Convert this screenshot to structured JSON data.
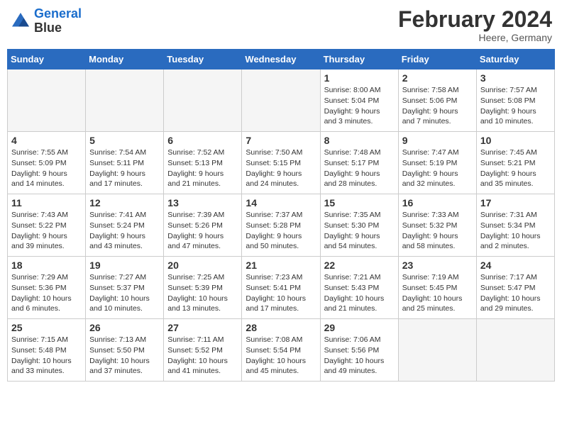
{
  "header": {
    "logo_line1": "General",
    "logo_line2": "Blue",
    "month_title": "February 2024",
    "subtitle": "Heere, Germany"
  },
  "days_of_week": [
    "Sunday",
    "Monday",
    "Tuesday",
    "Wednesday",
    "Thursday",
    "Friday",
    "Saturday"
  ],
  "weeks": [
    [
      {
        "day": "",
        "info": ""
      },
      {
        "day": "",
        "info": ""
      },
      {
        "day": "",
        "info": ""
      },
      {
        "day": "",
        "info": ""
      },
      {
        "day": "1",
        "info": "Sunrise: 8:00 AM\nSunset: 5:04 PM\nDaylight: 9 hours\nand 3 minutes."
      },
      {
        "day": "2",
        "info": "Sunrise: 7:58 AM\nSunset: 5:06 PM\nDaylight: 9 hours\nand 7 minutes."
      },
      {
        "day": "3",
        "info": "Sunrise: 7:57 AM\nSunset: 5:08 PM\nDaylight: 9 hours\nand 10 minutes."
      }
    ],
    [
      {
        "day": "4",
        "info": "Sunrise: 7:55 AM\nSunset: 5:09 PM\nDaylight: 9 hours\nand 14 minutes."
      },
      {
        "day": "5",
        "info": "Sunrise: 7:54 AM\nSunset: 5:11 PM\nDaylight: 9 hours\nand 17 minutes."
      },
      {
        "day": "6",
        "info": "Sunrise: 7:52 AM\nSunset: 5:13 PM\nDaylight: 9 hours\nand 21 minutes."
      },
      {
        "day": "7",
        "info": "Sunrise: 7:50 AM\nSunset: 5:15 PM\nDaylight: 9 hours\nand 24 minutes."
      },
      {
        "day": "8",
        "info": "Sunrise: 7:48 AM\nSunset: 5:17 PM\nDaylight: 9 hours\nand 28 minutes."
      },
      {
        "day": "9",
        "info": "Sunrise: 7:47 AM\nSunset: 5:19 PM\nDaylight: 9 hours\nand 32 minutes."
      },
      {
        "day": "10",
        "info": "Sunrise: 7:45 AM\nSunset: 5:21 PM\nDaylight: 9 hours\nand 35 minutes."
      }
    ],
    [
      {
        "day": "11",
        "info": "Sunrise: 7:43 AM\nSunset: 5:22 PM\nDaylight: 9 hours\nand 39 minutes."
      },
      {
        "day": "12",
        "info": "Sunrise: 7:41 AM\nSunset: 5:24 PM\nDaylight: 9 hours\nand 43 minutes."
      },
      {
        "day": "13",
        "info": "Sunrise: 7:39 AM\nSunset: 5:26 PM\nDaylight: 9 hours\nand 47 minutes."
      },
      {
        "day": "14",
        "info": "Sunrise: 7:37 AM\nSunset: 5:28 PM\nDaylight: 9 hours\nand 50 minutes."
      },
      {
        "day": "15",
        "info": "Sunrise: 7:35 AM\nSunset: 5:30 PM\nDaylight: 9 hours\nand 54 minutes."
      },
      {
        "day": "16",
        "info": "Sunrise: 7:33 AM\nSunset: 5:32 PM\nDaylight: 9 hours\nand 58 minutes."
      },
      {
        "day": "17",
        "info": "Sunrise: 7:31 AM\nSunset: 5:34 PM\nDaylight: 10 hours\nand 2 minutes."
      }
    ],
    [
      {
        "day": "18",
        "info": "Sunrise: 7:29 AM\nSunset: 5:36 PM\nDaylight: 10 hours\nand 6 minutes."
      },
      {
        "day": "19",
        "info": "Sunrise: 7:27 AM\nSunset: 5:37 PM\nDaylight: 10 hours\nand 10 minutes."
      },
      {
        "day": "20",
        "info": "Sunrise: 7:25 AM\nSunset: 5:39 PM\nDaylight: 10 hours\nand 13 minutes."
      },
      {
        "day": "21",
        "info": "Sunrise: 7:23 AM\nSunset: 5:41 PM\nDaylight: 10 hours\nand 17 minutes."
      },
      {
        "day": "22",
        "info": "Sunrise: 7:21 AM\nSunset: 5:43 PM\nDaylight: 10 hours\nand 21 minutes."
      },
      {
        "day": "23",
        "info": "Sunrise: 7:19 AM\nSunset: 5:45 PM\nDaylight: 10 hours\nand 25 minutes."
      },
      {
        "day": "24",
        "info": "Sunrise: 7:17 AM\nSunset: 5:47 PM\nDaylight: 10 hours\nand 29 minutes."
      }
    ],
    [
      {
        "day": "25",
        "info": "Sunrise: 7:15 AM\nSunset: 5:48 PM\nDaylight: 10 hours\nand 33 minutes."
      },
      {
        "day": "26",
        "info": "Sunrise: 7:13 AM\nSunset: 5:50 PM\nDaylight: 10 hours\nand 37 minutes."
      },
      {
        "day": "27",
        "info": "Sunrise: 7:11 AM\nSunset: 5:52 PM\nDaylight: 10 hours\nand 41 minutes."
      },
      {
        "day": "28",
        "info": "Sunrise: 7:08 AM\nSunset: 5:54 PM\nDaylight: 10 hours\nand 45 minutes."
      },
      {
        "day": "29",
        "info": "Sunrise: 7:06 AM\nSunset: 5:56 PM\nDaylight: 10 hours\nand 49 minutes."
      },
      {
        "day": "",
        "info": ""
      },
      {
        "day": "",
        "info": ""
      }
    ]
  ]
}
